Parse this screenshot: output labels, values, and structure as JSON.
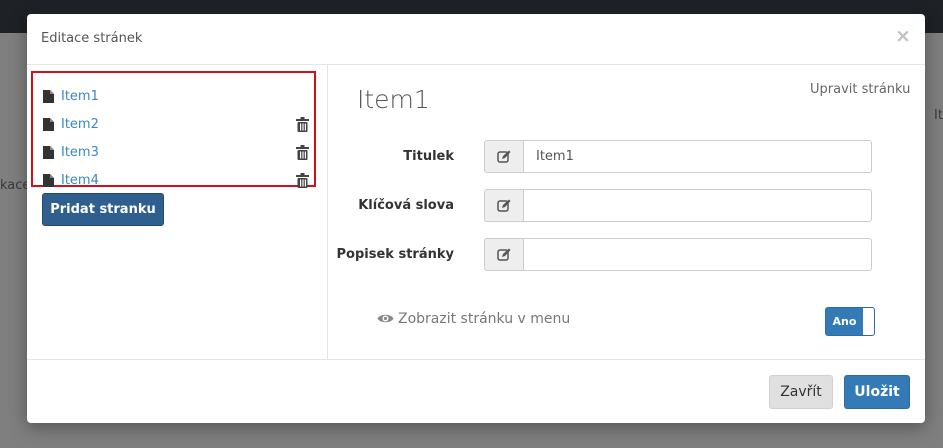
{
  "background": {
    "left_fragment": "kace",
    "right_fragment": "It"
  },
  "modal": {
    "title": "Editace stránek",
    "close_symbol": "×"
  },
  "pages": [
    {
      "label": "Item1",
      "icon": "file-icon",
      "deletable": false
    },
    {
      "label": "Item2",
      "icon": "file-icon",
      "deletable": true
    },
    {
      "label": "Item3",
      "icon": "file-icon",
      "deletable": true
    },
    {
      "label": "Item4",
      "icon": "file-icon",
      "deletable": true
    }
  ],
  "add_page_button": "Pridat stranku",
  "editor": {
    "heading": "Item1",
    "edit_link": "Upravit stránku",
    "fields": {
      "title": {
        "label": "Titulek",
        "value": "Item1",
        "placeholder": ""
      },
      "keywords": {
        "label": "Klíčová slova",
        "value": "",
        "placeholder": ""
      },
      "description": {
        "label": "Popisek stránky",
        "value": "",
        "placeholder": ""
      }
    },
    "show_in_menu": {
      "label": "Zobrazit stránku v menu",
      "toggle_label": "Ano",
      "enabled": true
    }
  },
  "footer": {
    "close_button": "Zavřít",
    "save_button": "Uložit"
  },
  "colors": {
    "accent": "#337ab7",
    "link": "#3a87c8",
    "highlight_border": "#d0111b",
    "add_button": "#2e5f8f"
  }
}
